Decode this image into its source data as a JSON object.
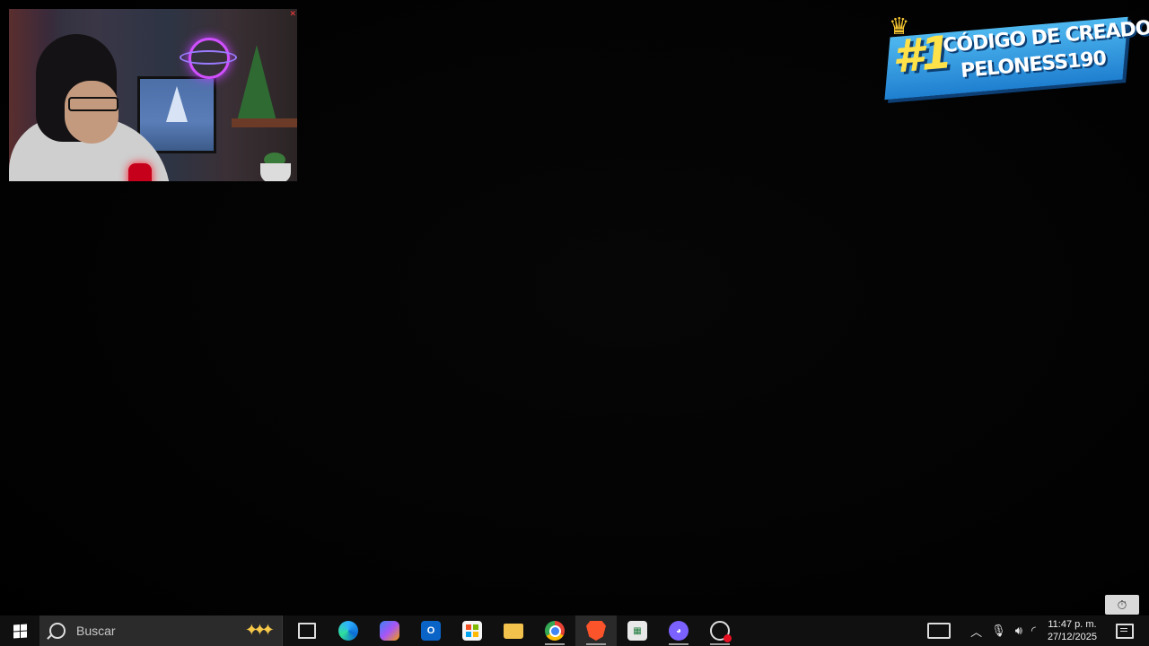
{
  "creator_code": {
    "rank": "#1",
    "line1": "CÓDIGO DE CREADOR:",
    "line2": "PELONESS190"
  },
  "taskbar": {
    "search_placeholder": "Buscar",
    "apps": [
      {
        "name": "task-view-icon"
      },
      {
        "name": "edge-icon"
      },
      {
        "name": "copilot-icon"
      },
      {
        "name": "outlook-icon",
        "label": "O"
      },
      {
        "name": "store-icon"
      },
      {
        "name": "file-explorer-icon"
      },
      {
        "name": "chrome-icon"
      },
      {
        "name": "brave-icon"
      },
      {
        "name": "sheets-icon"
      },
      {
        "name": "discord-icon"
      },
      {
        "name": "gauge-icon"
      }
    ],
    "clock": {
      "time": "11:47 p. m.",
      "date": "27/12/2025"
    }
  },
  "colors": {
    "taskbar_bg": "#101010",
    "banner_blue": "#1f7fd0",
    "banner_yellow": "#ffe14a"
  }
}
